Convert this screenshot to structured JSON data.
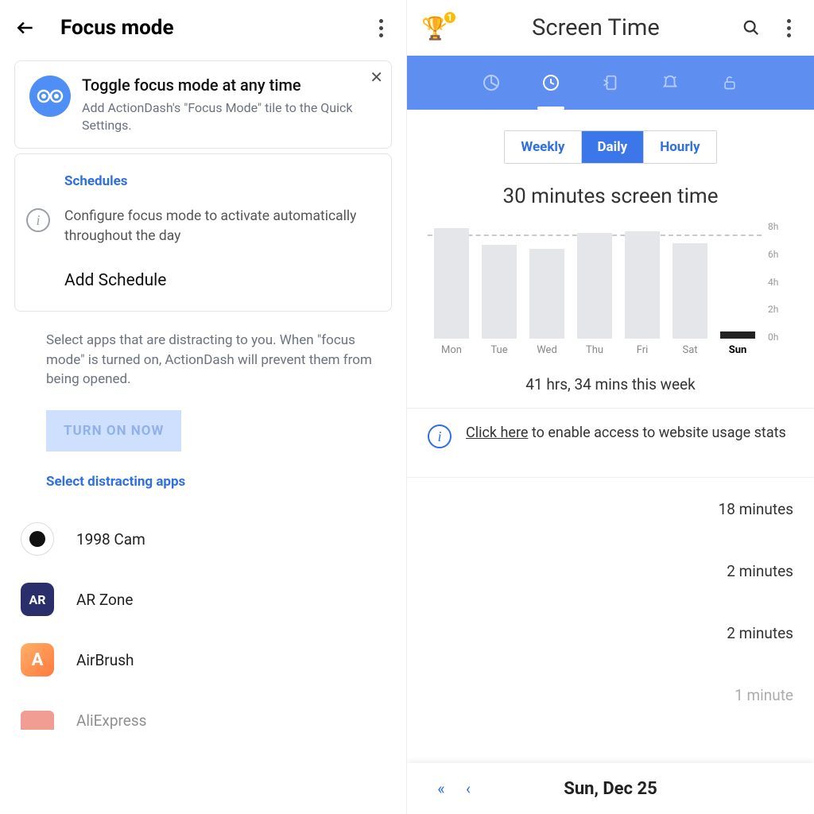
{
  "left": {
    "title": "Focus mode",
    "tip": {
      "title": "Toggle focus mode at any time",
      "subtitle": "Add ActionDash's \"Focus Mode\" tile to the Quick Settings."
    },
    "schedules": {
      "header": "Schedules",
      "info": "Configure focus mode to activate automatically throughout the day",
      "add": "Add Schedule"
    },
    "explain": "Select apps that are distracting to you. When \"focus mode\" is turned on, ActionDash will prevent them from being opened.",
    "turn_on": "TURN ON NOW",
    "select_apps": "Select distracting apps",
    "apps": [
      {
        "name": "1998 Cam"
      },
      {
        "name": "AR Zone"
      },
      {
        "name": "AirBrush"
      },
      {
        "name": "AliExpress"
      }
    ]
  },
  "right": {
    "title": "Screen Time",
    "badge": "1",
    "seg": [
      "Weekly",
      "Daily",
      "Hourly"
    ],
    "seg_selected": 1,
    "chart_title": "30 minutes screen time",
    "week_total": "41 hrs, 34 mins this week",
    "info_link": "Click here",
    "info_rest": " to enable access to website usage stats",
    "usage": [
      "18 minutes",
      "2 minutes",
      "2 minutes",
      "1 minute"
    ],
    "date": "Sun, Dec 25"
  },
  "chart_data": {
    "type": "bar",
    "categories": [
      "Mon",
      "Tue",
      "Wed",
      "Thu",
      "Fri",
      "Sat",
      "Sun"
    ],
    "values": [
      7.5,
      6.4,
      6.1,
      7.2,
      7.3,
      6.5,
      0.5
    ],
    "avg": 7.0,
    "ylabel_ticks": [
      "8h",
      "6h",
      "4h",
      "2h",
      "0h"
    ],
    "ylim": [
      0,
      8
    ]
  }
}
